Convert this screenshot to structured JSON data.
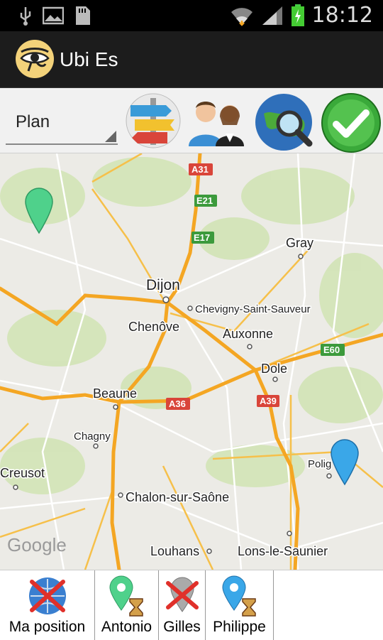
{
  "status_bar": {
    "time": "18:12"
  },
  "app": {
    "title": "Ubi Es"
  },
  "toolbar": {
    "map_type_value": "Plan"
  },
  "map": {
    "places": [
      "Dijon",
      "Chenôve",
      "Chevigny-Saint-Sauveur",
      "Auxonne",
      "Gray",
      "Dole",
      "Beaune",
      "Chagny",
      "Creusot",
      "Chalon-sur-Saône",
      "Louhans",
      "Lons-le-Saunier",
      "Polig"
    ],
    "roads": [
      "A31",
      "E21",
      "E17",
      "E60",
      "A36",
      "A39"
    ],
    "watermark": "Google"
  },
  "people": [
    {
      "label": "Ma position"
    },
    {
      "label": "Antonio"
    },
    {
      "label": "Gilles"
    },
    {
      "label": "Philippe"
    }
  ],
  "colors": {
    "marker_green": "#4fd18b",
    "marker_blue": "#3aa7e8",
    "road": "#f4a623",
    "accent_green": "#3aa93a"
  }
}
